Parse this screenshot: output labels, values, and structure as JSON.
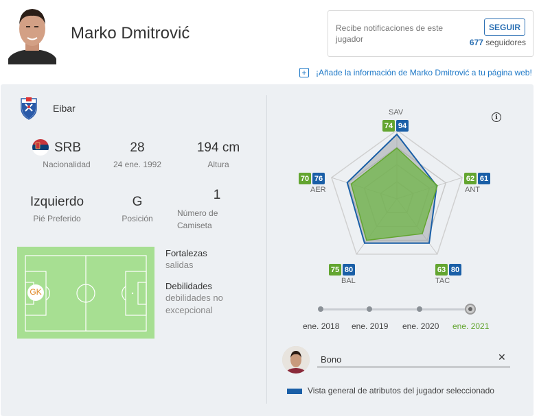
{
  "header": {
    "player_name": "Marko Dmitrović",
    "notify_text": "Recibe notificaciones de este jugador",
    "follow_label": "SEGUIR",
    "followers_count": "677",
    "followers_label": "seguidores",
    "add_info_text": "¡Añade la información de Marko Dmitrović a tu página web!"
  },
  "club": {
    "name": "Eibar"
  },
  "stats": {
    "nationality": {
      "value": "SRB",
      "label": "Nacionalidad"
    },
    "age": {
      "value": "28",
      "label": "24 ene. 1992"
    },
    "height": {
      "value": "194 cm",
      "label": "Altura"
    },
    "foot": {
      "value": "Izquierdo",
      "label": "Pié Preferido"
    },
    "position": {
      "value": "G",
      "label": "Posición"
    },
    "shirt": {
      "value": "1",
      "label": "Número de Camiseta"
    }
  },
  "pitch": {
    "position_marker": "GK"
  },
  "strengths": {
    "title": "Fortalezas",
    "text": "salidas",
    "weak_title": "Debilidades",
    "weak_text": "debilidades no excepcional"
  },
  "radar": {
    "axes": [
      {
        "label": "SAV",
        "player": 74,
        "compare": 94
      },
      {
        "label": "ANT",
        "player": 62,
        "compare": 61
      },
      {
        "label": "TAC",
        "player": 63,
        "compare": 80
      },
      {
        "label": "BAL",
        "player": 75,
        "compare": 80
      },
      {
        "label": "AER",
        "player": 70,
        "compare": 76
      }
    ],
    "colors": {
      "player": "#63a530",
      "compare": "#1a5fa7"
    }
  },
  "timeline": {
    "labels": [
      "ene. 2018",
      "ene. 2019",
      "ene. 2020",
      "ene. 2021"
    ],
    "active_index": 3
  },
  "compare": {
    "player_name": "Bono",
    "legend": "Vista general de atributos del jugador seleccionado"
  }
}
